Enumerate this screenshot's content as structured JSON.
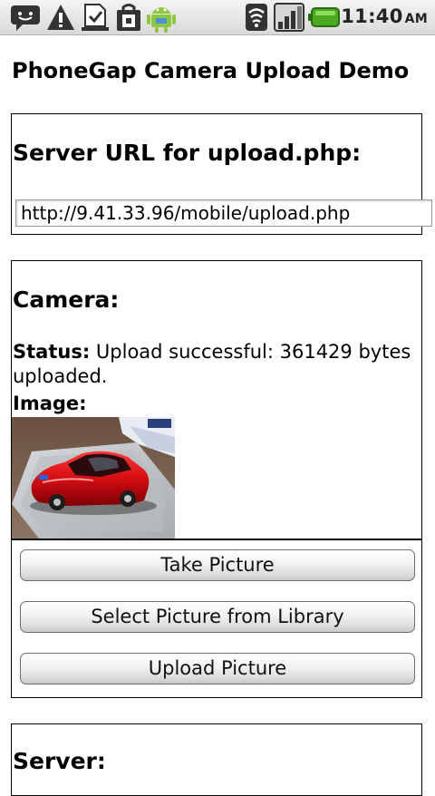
{
  "status_bar": {
    "time": "11:40",
    "ampm": "AM",
    "icons": [
      "chat-icon",
      "warning-icon",
      "download-done-icon",
      "shopping-bag-icon",
      "android-icon",
      "wifi-icon",
      "signal-icon",
      "battery-icon"
    ]
  },
  "page": {
    "title": "PhoneGap Camera Upload Demo"
  },
  "server_url_section": {
    "heading": "Server URL for upload.php:",
    "url_value": "http://9.41.33.96/mobile/upload.php"
  },
  "camera_section": {
    "heading": "Camera:",
    "status_label": "Status:",
    "status_text": "Upload successful: 361429 bytes uploaded.",
    "image_label": "Image:"
  },
  "buttons": {
    "take_picture": "Take Picture",
    "select_picture": "Select Picture from Library",
    "upload_picture": "Upload Picture"
  },
  "server_section": {
    "heading": "Server:"
  }
}
